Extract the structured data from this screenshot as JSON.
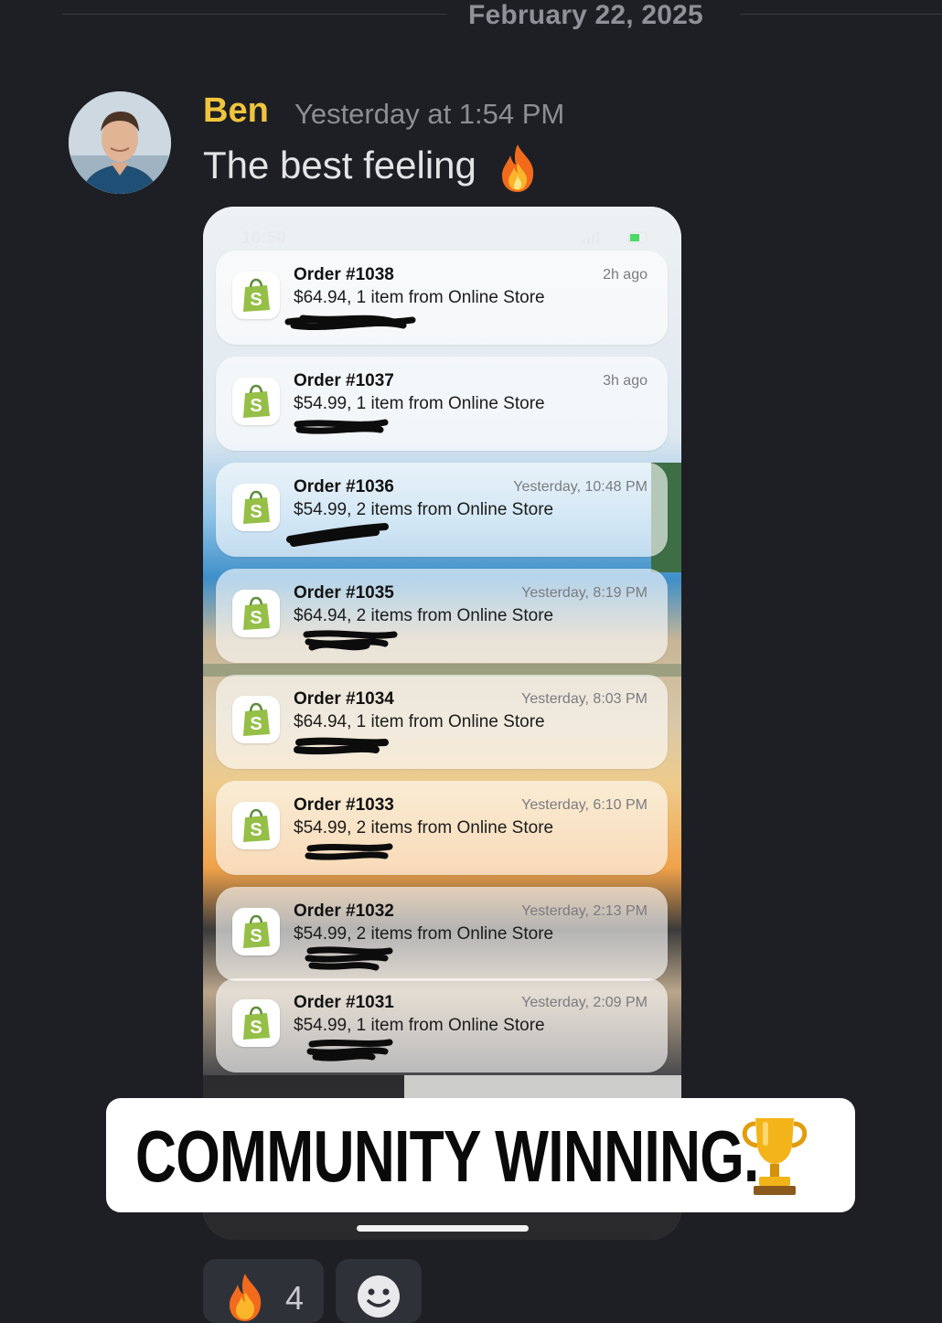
{
  "divider": {
    "date": "February 22, 2025"
  },
  "message": {
    "author": "Ben",
    "timestamp": "Yesterday at 1:54 PM",
    "text": "The best feeling",
    "emoji": "fire-emoji",
    "author_color": "#f0c53d"
  },
  "phone": {
    "status_time": "10:50",
    "notifications": [
      {
        "title": "Order #1038",
        "body": "$64.94, 1 item from Online Store",
        "time": "2h ago"
      },
      {
        "title": "Order #1037",
        "body": "$54.99, 1 item from Online Store",
        "time": "3h ago"
      },
      {
        "title": "Order #1036",
        "body": "$54.99, 2 items from Online Store",
        "time": "Yesterday, 10:48 PM"
      },
      {
        "title": "Order #1035",
        "body": "$64.94, 2 items from Online Store",
        "time": "Yesterday, 8:19 PM"
      },
      {
        "title": "Order #1034",
        "body": "$64.94, 1 item from Online Store",
        "time": "Yesterday, 8:03 PM"
      },
      {
        "title": "Order #1033",
        "body": "$54.99, 2 items from Online Store",
        "time": "Yesterday, 6:10 PM"
      },
      {
        "title": "Order #1032",
        "body": "$54.99, 2 items from Online Store",
        "time": "Yesterday, 2:13 PM"
      },
      {
        "title": "Order #1031",
        "body": "$54.99, 1 item from Online Store",
        "time": "Yesterday, 2:09 PM"
      }
    ],
    "app_icon": "shopify-icon",
    "app_color": "#95bf47"
  },
  "banner": {
    "text": "COMMUNITY WINNING.",
    "emoji": "trophy-emoji"
  },
  "reactions": [
    {
      "emoji": "fire-emoji",
      "count": "4"
    },
    {
      "emoji": "add-reaction-icon",
      "count": ""
    }
  ]
}
